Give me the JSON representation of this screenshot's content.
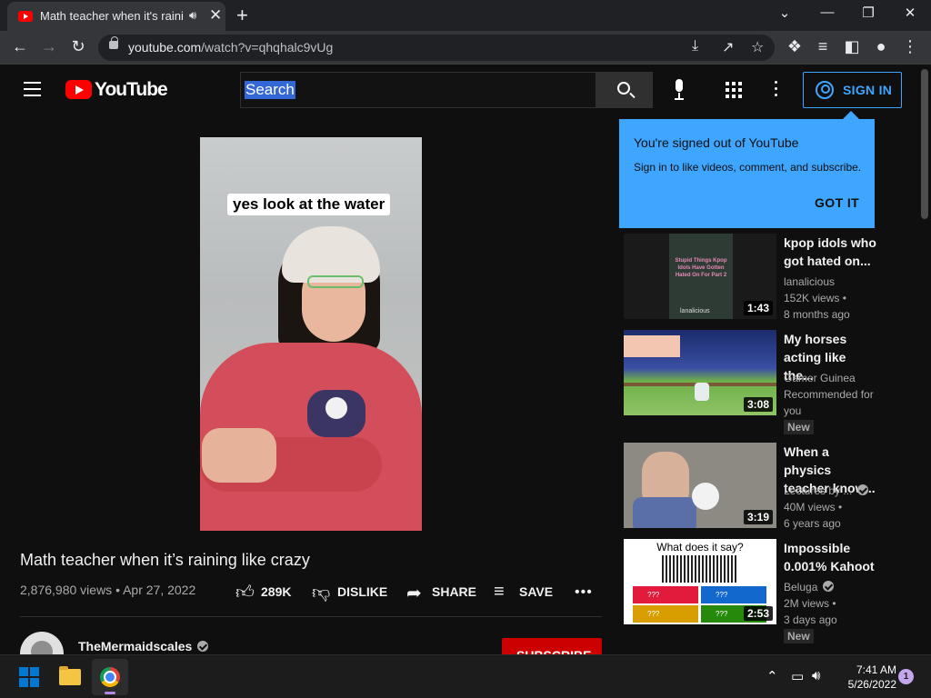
{
  "browser": {
    "tab_title": "Math teacher when it's raining like crazy - YouTube",
    "url_host": "youtube.com",
    "url_path": "/watch?v=qhqhalc9vUg"
  },
  "youtube": {
    "logo_text": "YouTube",
    "search_value": "Search",
    "sign_in_label": "SIGN IN"
  },
  "popup": {
    "heading": "You're signed out of YouTube",
    "body": "Sign in to like videos, comment, and subscribe.",
    "button": "GOT IT"
  },
  "video": {
    "caption_overlay": "yes look at the water",
    "title": "Math teacher when it’s raining like crazy",
    "meta": "2,876,980 views • Apr 27, 2022",
    "likes": "289K",
    "dislike_label": "DISLIKE",
    "share_label": "SHARE",
    "save_label": "SAVE",
    "channel_name": "TheMermaidscales",
    "subscribe_label": "SUBSCRIBE"
  },
  "recommendations": [
    {
      "title": "kpop idols who got hated on...",
      "channel": "lanalicious",
      "views": "152K views •",
      "age": "8 months ago",
      "duration": "1:43",
      "thumb_caption": "Stupid Things Kpop Idols Have Gotten Hated On For Part 2",
      "watermark": "lanalicious"
    },
    {
      "title": "My horses acting like the...",
      "channel": "Gamer Guinea",
      "extra": "Recommended for you",
      "badge": "New",
      "duration": "3:08"
    },
    {
      "title": "When a physics teacher know...",
      "channel": "Lectures by ...",
      "views": "40M views •",
      "age": "6 years ago",
      "duration": "3:19"
    },
    {
      "title": "Impossible 0.001% Kahoot",
      "channel": "Beluga",
      "views": "2M views •",
      "age": "3 days ago",
      "badge": "New",
      "duration": "2:53",
      "thumb_heading": "What does it say?",
      "answers": [
        "???",
        "???",
        "???",
        "???"
      ]
    }
  ],
  "taskbar": {
    "time": "7:41 AM",
    "date": "5/26/2022",
    "notifications": "1"
  },
  "colors": {
    "accent_blue": "#3ea6ff",
    "youtube_red": "#ff0000",
    "subscribe_red": "#cc0000"
  }
}
